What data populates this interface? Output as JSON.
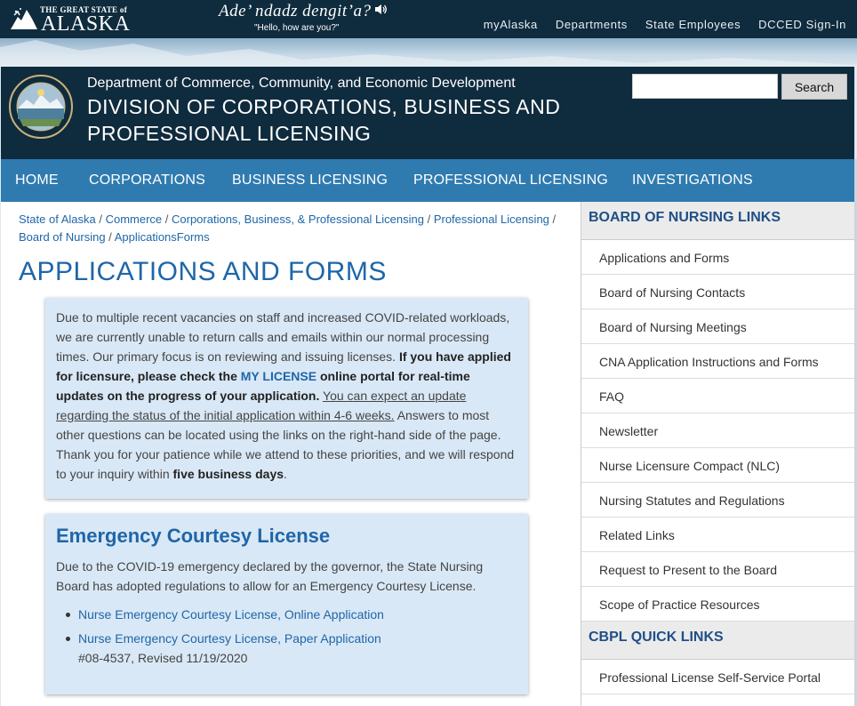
{
  "topbar": {
    "logo_small": "THE GREAT STATE of",
    "logo_big": "ALASKA",
    "greeting_native": "Ade’ ndadz dengit’a?",
    "greeting_translation": "\"Hello, how are you?\"",
    "nav": [
      "myAlaska",
      "Departments",
      "State Employees",
      "DCCED Sign-In"
    ]
  },
  "header": {
    "department": "Department of Commerce, Community, and Economic Development",
    "division": "DIVISION OF CORPORATIONS, BUSINESS AND PROFESSIONAL LICENSING",
    "search_button": "Search",
    "search_placeholder": ""
  },
  "mainnav": [
    "HOME",
    "CORPORATIONS",
    "BUSINESS LICENSING",
    "PROFESSIONAL LICENSING",
    "INVESTIGATIONS"
  ],
  "breadcrumb": [
    "State of Alaska",
    "Commerce",
    "Corporations, Business, & Professional Licensing",
    "Professional Licensing",
    "Board of Nursing",
    "ApplicationsForms"
  ],
  "page_title": "APPLICATIONS AND FORMS",
  "notice": {
    "p1": "Due to multiple recent vacancies on staff and increased COVID-related workloads, we are currently unable to return calls and emails within our normal processing times. Our primary focus is on reviewing and issuing licenses.",
    "b1": "If you have applied for licensure, please check the",
    "link": "MY LICENSE",
    "b2": "online portal for real-time updates on the progress of your application.",
    "u1": "You can expect an update regarding the status of the initial application within 4-6 weeks.",
    "p2": "Answers to most other questions can be located using the links on the right-hand side of the page. Thank you for your patience while we attend to these priorities, and we will respond to your inquiry within",
    "b3": "five business days",
    "end": "."
  },
  "ecl": {
    "title": "Emergency Courtesy License",
    "body": "Due to the COVID-19 emergency declared by the governor, the State Nursing Board has adopted regulations to allow for an Emergency Courtesy License.",
    "items": [
      {
        "label": "Nurse Emergency Courtesy License, Online Application",
        "meta": ""
      },
      {
        "label": "Nurse Emergency Courtesy License, Paper Application",
        "meta": "#08-4537, Revised 11/19/2020"
      }
    ]
  },
  "sidebar": {
    "section1_title": "BOARD OF NURSING LINKS",
    "section1_items": [
      "Applications and Forms",
      "Board of Nursing Contacts",
      "Board of Nursing Meetings",
      "CNA Application Instructions and Forms",
      "FAQ",
      "Newsletter",
      "Nurse Licensure Compact (NLC)",
      "Nursing Statutes and Regulations",
      "Related Links",
      "Request to Present to the Board",
      "Scope of Practice Resources"
    ],
    "section2_title": "CBPL QUICK LINKS",
    "section2_items": [
      "Professional License Self-Service Portal"
    ]
  },
  "colors": {
    "dark_navy": "#0f2b3e",
    "nav_blue": "#2f7bb0",
    "link_blue": "#1f66a8",
    "notice_bg": "#d9e8f6"
  },
  "icons": [
    "flag-icon",
    "speaker-icon",
    "state-seal-icon"
  ]
}
